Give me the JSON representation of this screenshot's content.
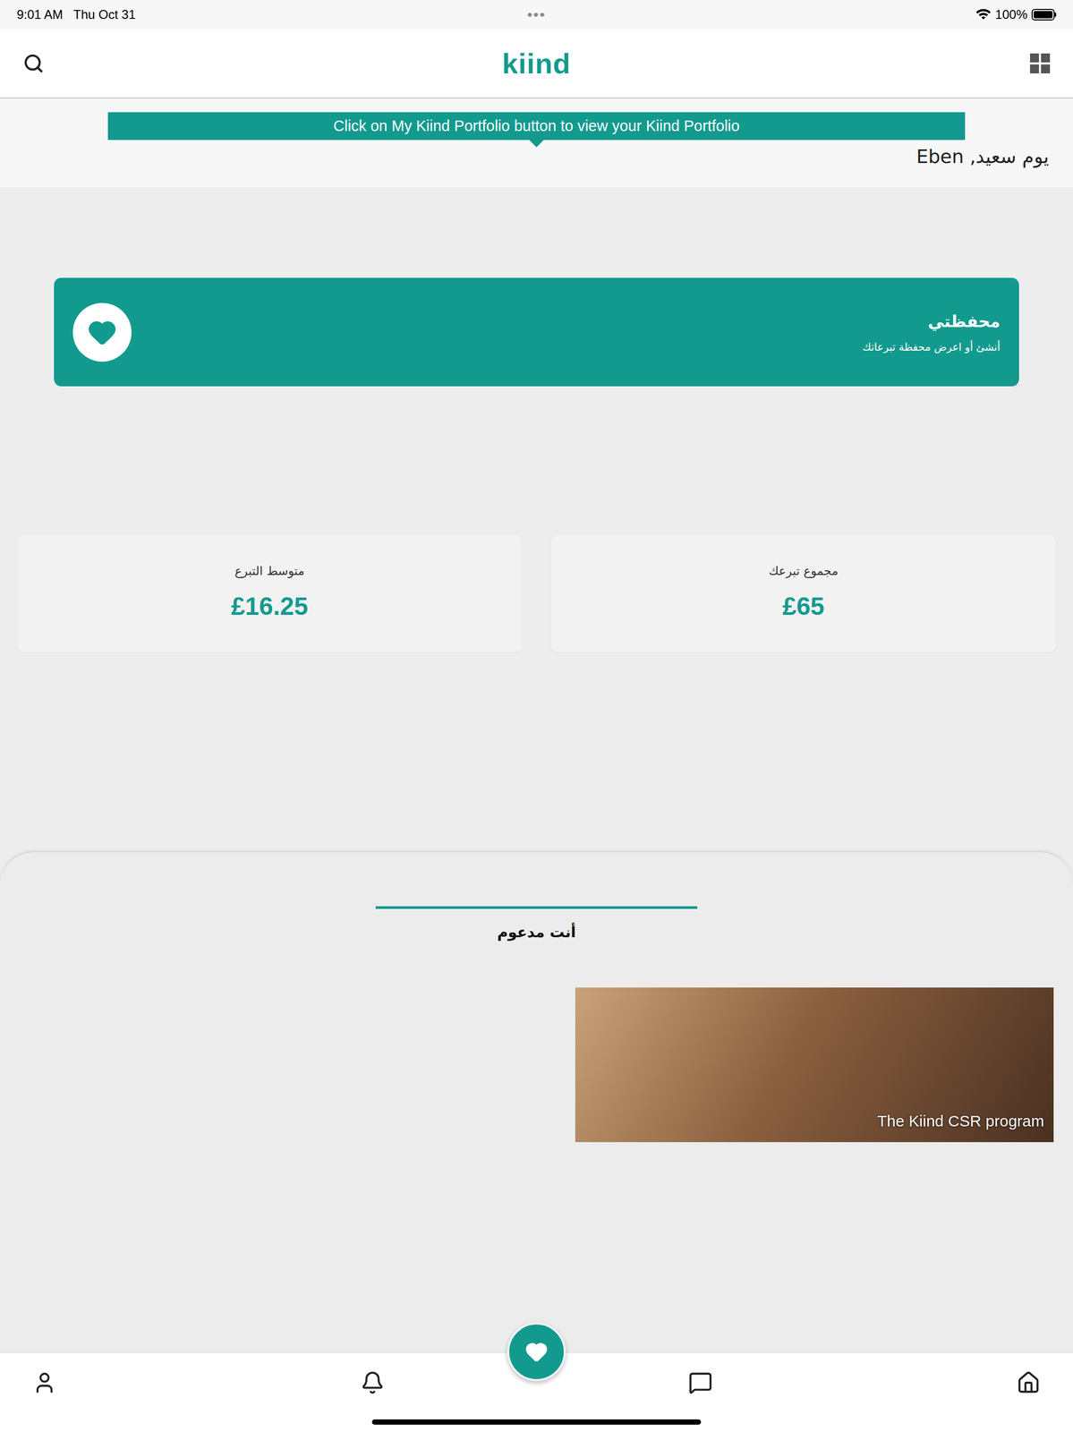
{
  "status_bar": {
    "time": "9:01 AM",
    "date": "Thu Oct 31",
    "dots": "•••",
    "battery": "100%",
    "battery_level": 1
  },
  "header": {
    "logo": "kiind"
  },
  "tooltip": {
    "text": "Click on My Kiind Portfolio button to view your Kiind Portfolio"
  },
  "greeting": "يوم سعيد, Eben",
  "portfolio": {
    "title": "محفظتي",
    "subtitle": "أنشئ أو اعرض محفظة تبرعاتك"
  },
  "stats": [
    {
      "label": "مجموع تبرعك",
      "value": "£65"
    },
    {
      "label": "متوسط التبرع",
      "value": "£16.25"
    }
  ],
  "tabs": [
    {
      "label": "أنت مدعوم",
      "selected": true
    }
  ],
  "cards": [
    {
      "title": "The Kiind CSR program"
    }
  ]
}
